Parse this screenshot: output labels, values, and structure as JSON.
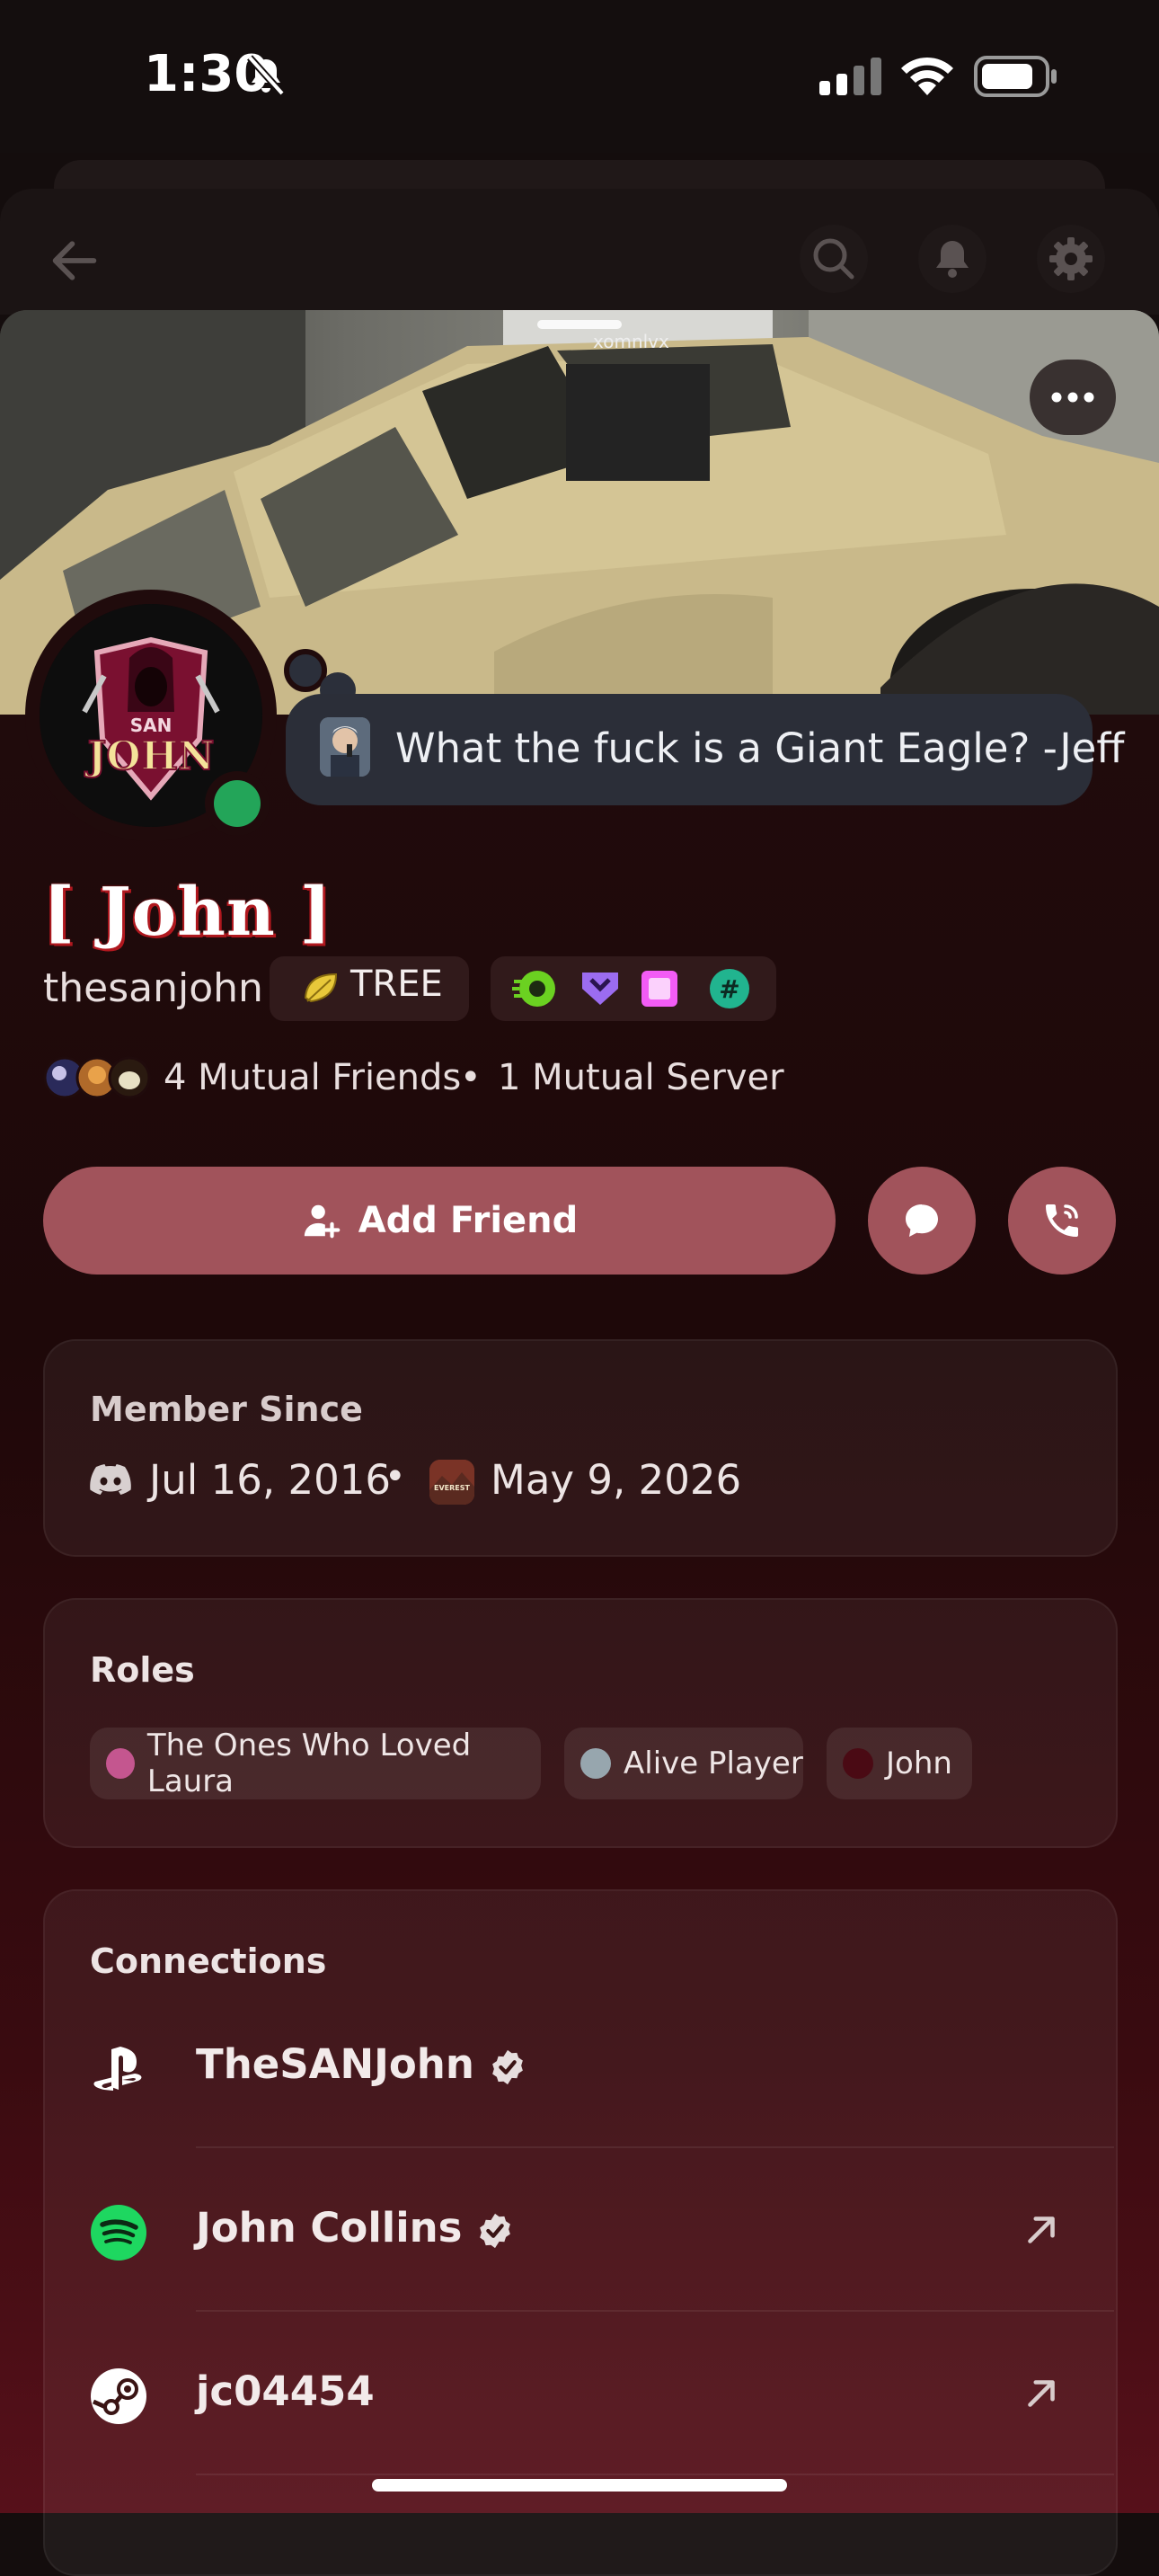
{
  "status_bar": {
    "time": "1:30",
    "silent_icon": "bell-slash-icon",
    "signal_icon": "cellular-signal-icon",
    "wifi_icon": "wifi-icon",
    "battery_icon": "battery-icon"
  },
  "nav": {
    "back_icon": "arrow-left-icon",
    "search_icon": "search-icon",
    "bell_icon": "bell-icon",
    "gear_icon": "gear-icon"
  },
  "banner": {
    "overlay_text": "xomnlvx",
    "more_icon": "more-horizontal-icon"
  },
  "profile": {
    "display_name": "[ John ]",
    "username": "thesanjohn",
    "avatar_text": "SAN JOHN",
    "status": "online",
    "custom_status": "What the fuck is a Giant Eagle? -Jeff",
    "tag": "TREE",
    "badges": [
      "nitro-icon",
      "hypesquad-icon",
      "quest-icon",
      "hashtag-icon"
    ]
  },
  "mutuals": {
    "friends": "4 Mutual Friends",
    "separator": "•",
    "servers": "1 Mutual Server"
  },
  "actions": {
    "add_friend": "Add Friend",
    "message_icon": "chat-bubble-icon",
    "call_icon": "phone-icon"
  },
  "member_since": {
    "title": "Member Since",
    "discord_date": "Jul 16, 2016",
    "separator": "•",
    "server_date": "May 9, 2026",
    "server_icon_text": "EVEREST"
  },
  "roles": {
    "title": "Roles",
    "items": [
      {
        "label": "The Ones Who Loved Laura",
        "color": "#c4568f"
      },
      {
        "label": "Alive Player",
        "color": "#97a6ae"
      },
      {
        "label": "John",
        "color": "#4a0a14"
      }
    ]
  },
  "connections": {
    "title": "Connections",
    "items": [
      {
        "platform": "playstation",
        "name": "TheSANJohn",
        "verified": true,
        "link": false
      },
      {
        "platform": "spotify",
        "name": "John Collins",
        "verified": true,
        "link": true
      },
      {
        "platform": "steam",
        "name": "jc04454",
        "verified": false,
        "link": true
      }
    ]
  },
  "colors": {
    "accent": "#a1535b",
    "online": "#23a559",
    "spotify": "#1ed760"
  }
}
